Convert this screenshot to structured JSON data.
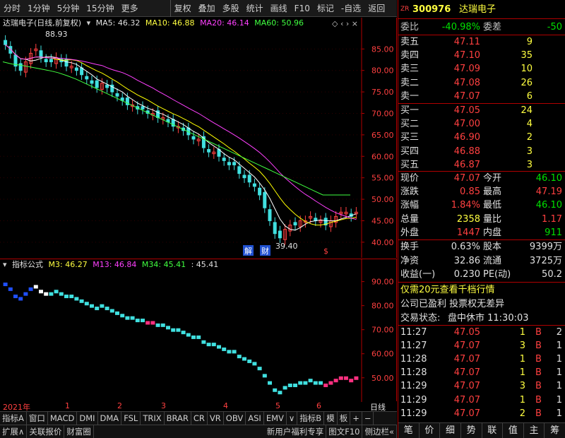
{
  "toolbar": {
    "left": [
      "分时",
      "1分钟",
      "5分钟",
      "15分钟",
      "更多"
    ],
    "right": [
      "复权",
      "叠加",
      "多股",
      "统计",
      "画线",
      "F10",
      "标记",
      "-自选",
      "返回"
    ]
  },
  "main_chart": {
    "title": "达瑞电子(日线,前复权)",
    "ma5": "MA5: 46.32",
    "ma10": "MA10: 46.88",
    "ma20": "MA20: 46.14",
    "ma60": "MA60: 50.96",
    "y_labels": [
      "85.00",
      "80.00",
      "75.00",
      "70.00",
      "65.00",
      "60.00",
      "55.00",
      "50.00",
      "45.00",
      "40.00"
    ],
    "high_marker": "88.93",
    "low_marker": "39.40",
    "events": [
      "解",
      "财",
      "$"
    ]
  },
  "indicator_chart": {
    "title": "指标公式",
    "m3": "M3: 46.27",
    "m13": "M13: 46.84",
    "m34": "M34: 45.41",
    "extra": ": 45.41",
    "y_labels": [
      "90.00",
      "80.00",
      "70.00",
      "60.00",
      "50.00"
    ]
  },
  "datebar": {
    "year": "2021年",
    "months": [
      "1",
      "2",
      "3",
      "4",
      "5",
      "6"
    ],
    "label": "日线"
  },
  "tabs": [
    "指标A",
    "窗口",
    "MACD",
    "DMI",
    "DMA",
    "FSL",
    "TRIX",
    "BRAR",
    "CR",
    "VR",
    "OBV",
    "ASI",
    "EMV",
    "∨",
    "指标B",
    "模",
    "板",
    "+",
    "−"
  ],
  "status": [
    "扩展∧",
    "关联报价",
    "财富圈",
    "新用户福利专享",
    "图文F10",
    "侧边栏«"
  ],
  "quote": {
    "badge": "ZR",
    "code": "300976",
    "name": "达瑞电子",
    "weibi_label": "委比",
    "weibi_value": "-40.98%",
    "weicha_label": "委差",
    "weicha_value": "-50",
    "sells": [
      {
        "label": "卖五",
        "price": "47.11",
        "vol": "9"
      },
      {
        "label": "卖四",
        "price": "47.10",
        "vol": "35"
      },
      {
        "label": "卖三",
        "price": "47.09",
        "vol": "10"
      },
      {
        "label": "卖二",
        "price": "47.08",
        "vol": "26"
      },
      {
        "label": "卖一",
        "price": "47.07",
        "vol": "6"
      }
    ],
    "buys": [
      {
        "label": "买一",
        "price": "47.05",
        "vol": "24"
      },
      {
        "label": "买二",
        "price": "47.00",
        "vol": "4"
      },
      {
        "label": "买三",
        "price": "46.90",
        "vol": "2"
      },
      {
        "label": "买四",
        "price": "46.88",
        "vol": "3"
      },
      {
        "label": "买五",
        "price": "46.87",
        "vol": "3"
      }
    ],
    "stats": [
      {
        "l1": "现价",
        "v1": "47.07",
        "c1": "red",
        "l2": "今开",
        "v2": "46.10",
        "c2": "green"
      },
      {
        "l1": "涨跌",
        "v1": "0.85",
        "c1": "red",
        "l2": "最高",
        "v2": "47.19",
        "c2": "red"
      },
      {
        "l1": "涨幅",
        "v1": "1.84%",
        "c1": "red",
        "l2": "最低",
        "v2": "46.10",
        "c2": "green"
      },
      {
        "l1": "总量",
        "v1": "2358",
        "c1": "yellow",
        "l2": "量比",
        "v2": "1.17",
        "c2": "red"
      },
      {
        "l1": "外盘",
        "v1": "1447",
        "c1": "red",
        "l2": "内盘",
        "v2": "911",
        "c2": "green"
      }
    ],
    "stats2": [
      {
        "l1": "换手",
        "v1": "0.63%",
        "l2": "股本",
        "v2": "9399万"
      },
      {
        "l1": "净资",
        "v1": "32.86",
        "l2": "流通",
        "v2": "3725万"
      },
      {
        "l1": "收益(一)",
        "v1": "0.230",
        "l2": "PE(动)",
        "v2": "50.2"
      }
    ],
    "promo": "仅需20元查看千档行情",
    "notice": "公司已盈利 投票权无差异",
    "trade_state_label": "交易状态:",
    "trade_state": "盘中休市 11:30:03",
    "ticks": [
      {
        "time": "11:27",
        "price": "47.05",
        "vol": "1",
        "side": "B",
        "n": "2"
      },
      {
        "time": "11:27",
        "price": "47.07",
        "vol": "3",
        "side": "B",
        "n": "1"
      },
      {
        "time": "11:28",
        "price": "47.07",
        "vol": "1",
        "side": "B",
        "n": "1"
      },
      {
        "time": "11:28",
        "price": "47.07",
        "vol": "1",
        "side": "B",
        "n": "1"
      },
      {
        "time": "11:29",
        "price": "47.07",
        "vol": "3",
        "side": "B",
        "n": "1"
      },
      {
        "time": "11:29",
        "price": "47.07",
        "vol": "1",
        "side": "B",
        "n": "1"
      },
      {
        "time": "11:29",
        "price": "47.07",
        "vol": "2",
        "side": "B",
        "n": "1"
      }
    ],
    "bottom_tabs": [
      "笔",
      "价",
      "细",
      "势",
      "联",
      "值",
      "主",
      "筹"
    ]
  },
  "colors": {
    "up": "#ff4040",
    "down": "#40e0e0",
    "ma5": "#ffffff",
    "ma10": "#ffff00",
    "ma20": "#ff40ff",
    "ma60": "#40ff40",
    "border": "#b00000"
  },
  "chart_data": {
    "type": "line",
    "title": "达瑞电子(日线,前复权)",
    "ylim": [
      38,
      89
    ],
    "close": [
      86,
      84,
      81,
      80,
      82,
      84,
      85,
      83,
      82,
      82,
      83,
      82,
      81,
      81,
      80,
      79,
      78,
      77,
      76,
      77,
      76,
      75,
      74,
      73,
      72,
      72,
      71,
      71,
      70,
      70,
      69,
      69,
      68,
      67,
      67,
      66,
      65,
      64,
      64,
      62,
      61,
      61,
      60,
      59,
      58,
      58,
      56,
      55,
      54,
      53,
      51,
      48,
      45,
      42,
      41,
      43,
      44,
      44,
      45,
      45,
      46,
      45,
      45,
      44,
      45,
      46,
      47,
      47,
      46,
      47
    ],
    "ma60": [
      82,
      81.5,
      81.2,
      80.8,
      80.4,
      80,
      79.5,
      78.8,
      78,
      77,
      76,
      75,
      74,
      73,
      72,
      71,
      70,
      69,
      68,
      67,
      66,
      65,
      64,
      63,
      62,
      61,
      60,
      59,
      58,
      57,
      56,
      55,
      54,
      53,
      52,
      51,
      51,
      51,
      51
    ]
  }
}
